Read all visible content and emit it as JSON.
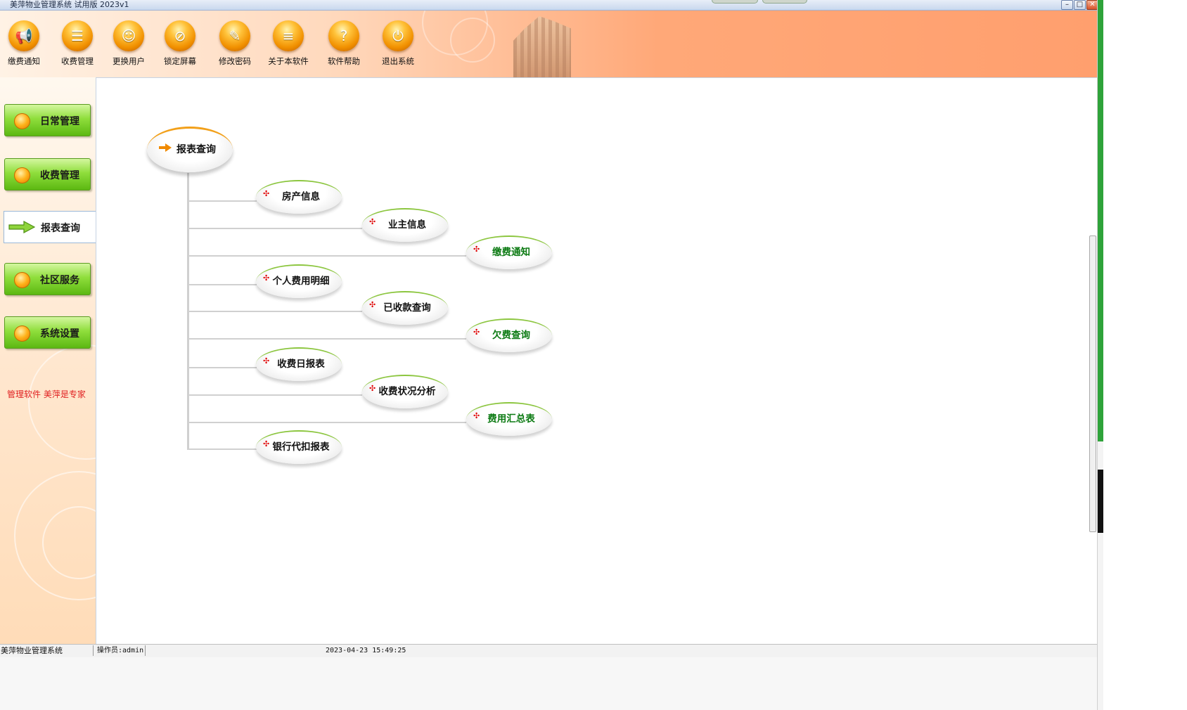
{
  "window": {
    "title": "美萍物业管理系统 试用版 2023v1",
    "minimize_glyph": "–",
    "maximize_glyph": "□",
    "close_glyph": "✕"
  },
  "toolbar": {
    "items": [
      {
        "label": "缴费通知",
        "icon": "megaphone-icon",
        "glyph": "📢"
      },
      {
        "label": "收费管理",
        "icon": "ledger-icon",
        "glyph": "☰"
      },
      {
        "label": "更换用户",
        "icon": "user-switch-icon",
        "glyph": "☺"
      },
      {
        "label": "锁定屏幕",
        "icon": "lock-screen-icon",
        "glyph": "⊘"
      },
      {
        "label": "修改密码",
        "icon": "key-icon",
        "glyph": "✎"
      },
      {
        "label": "关于本软件",
        "icon": "about-icon",
        "glyph": "≡"
      },
      {
        "label": "软件帮助",
        "icon": "help-icon",
        "glyph": "?"
      },
      {
        "label": "退出系统",
        "icon": "power-icon",
        "glyph": "⏻"
      }
    ]
  },
  "sidebar": {
    "items": [
      {
        "label": "日常管理",
        "active": false
      },
      {
        "label": "收费管理",
        "active": false
      },
      {
        "label": "报表查询",
        "active": true
      },
      {
        "label": "社区服务",
        "active": false
      },
      {
        "label": "系统设置",
        "active": false
      }
    ],
    "slogan": "管理软件 美萍是专家"
  },
  "diagram": {
    "root": "报表查询",
    "nodes": [
      {
        "label": "房产信息",
        "color": "black"
      },
      {
        "label": "业主信息",
        "color": "black"
      },
      {
        "label": "缴费通知",
        "color": "green"
      },
      {
        "label": "个人费用明细",
        "color": "black"
      },
      {
        "label": "已收款查询",
        "color": "black"
      },
      {
        "label": "欠费查询",
        "color": "green"
      },
      {
        "label": "收费日报表",
        "color": "black"
      },
      {
        "label": "收费状况分析",
        "color": "black"
      },
      {
        "label": "费用汇总表",
        "color": "green"
      },
      {
        "label": "银行代扣报表",
        "color": "black"
      }
    ],
    "plus_glyph": "✣"
  },
  "statusbar": {
    "app_name": "美萍物业管理系统",
    "operator": "操作员:admin",
    "datetime": "2023-04-23 15:49:25"
  },
  "colors": {
    "nav_green": "#8fde3c",
    "toolbar_orange": "#ffa878",
    "node_green_text": "#0b7a12",
    "slogan_red": "#e02020"
  }
}
